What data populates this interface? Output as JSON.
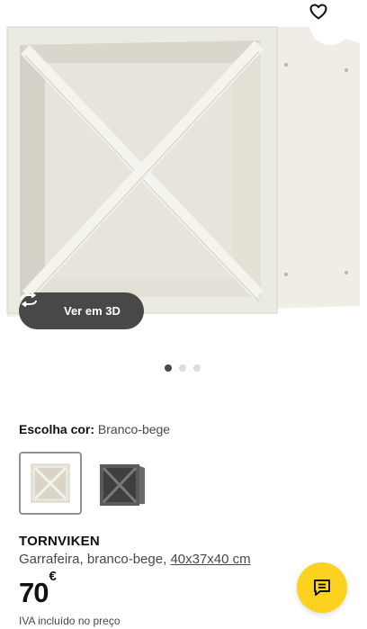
{
  "hero": {
    "image": "wine-rack-beige-x-divider",
    "favorite_icon": "heart-outline-icon",
    "view_3d_label": "Ver em 3D",
    "view_3d_icon": "rotate-3d-icon",
    "carousel": {
      "count": 3,
      "active": 1
    }
  },
  "color_picker": {
    "label": "Escolha cor:",
    "selected_value": "Branco-bege",
    "swatches": [
      {
        "color": "#e9e6dc",
        "selected": true
      },
      {
        "color": "#5b5b5b",
        "selected": false
      }
    ]
  },
  "product": {
    "name": "TORNVIKEN",
    "description": "Garrafeira, branco-bege,",
    "dimensions": "40x37x40 cm",
    "price": "70",
    "currency": "€",
    "vat_note": "IVA incluído no preço"
  },
  "colors": {
    "chat_button": "#fdd21f",
    "dark_pill": "#484848"
  },
  "chat_icon": "chat-bubble-icon"
}
